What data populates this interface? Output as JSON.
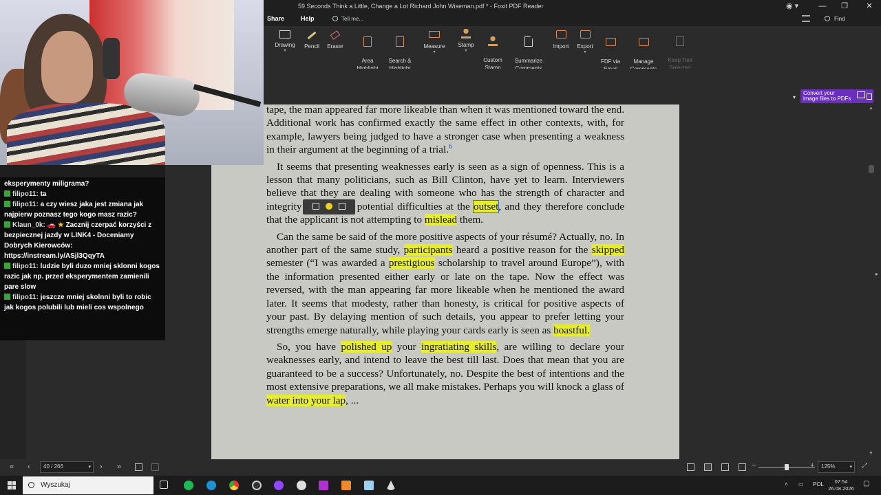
{
  "window": {
    "title": "59 Seconds Think a Little, Change a Lot Richard John Wiseman.pdf * - Foxit PDF Reader",
    "minimize": "—",
    "restore": "❐",
    "close": "✕",
    "user_icon": "user-icon"
  },
  "menu": {
    "tabs": [
      "Share",
      "Help"
    ],
    "tell_me": "Tell me...",
    "find": "Find"
  },
  "ribbon": {
    "buttons": [
      {
        "label": "Drawing",
        "icon": "rectangle-icon",
        "dropdown": true
      },
      {
        "label": "Pencil",
        "icon": "pencil-icon"
      },
      {
        "label": "Eraser",
        "icon": "eraser-icon"
      },
      {
        "label": "Area\nHighlight",
        "icon": "area-highlight-icon"
      },
      {
        "label": "Search &\nHighlight",
        "icon": "search-highlight-icon"
      },
      {
        "label": "Measure",
        "icon": "ruler-icon",
        "dropdown": true
      },
      {
        "label": "Stamp",
        "icon": "stamp-icon",
        "dropdown": true
      },
      {
        "label": "Custom\nStamp",
        "icon": "custom-stamp-icon",
        "dropdown": true
      },
      {
        "label": "Summarize\nComments",
        "icon": "summarize-icon"
      },
      {
        "label": "Import",
        "icon": "import-icon"
      },
      {
        "label": "Export",
        "icon": "export-icon",
        "dropdown": true
      },
      {
        "label": "FDF via\nEmail",
        "icon": "fdf-email-icon"
      },
      {
        "label": "Manage\nComments",
        "icon": "manage-comments-icon",
        "dropdown": true
      },
      {
        "label": "Keep Tool\nSelected",
        "icon": "keep-tool-icon",
        "disabled": true
      }
    ],
    "convert_banner": "Convert your\nimage files to PDFs"
  },
  "document": {
    "paragraphs": [
      {
        "indent": false,
        "segments": [
          {
            "t": "tape, the man appeared far more likeable than when it was mentioned toward the end. Additional work has confirmed exactly the same effect in other contexts, with, for example, lawyers being judged to have a stronger case when presenting a weakness in their argument at the beginning of a trial."
          },
          {
            "t": "6",
            "sup": true
          }
        ]
      },
      {
        "indent": true,
        "segments": [
          {
            "t": "It seems that presenting weaknesses early is seen as a sign of openness. This is a lesson that many politicians, such as Bill Clinton, have yet to learn. Interviewers believe that they are dealing with someone who has the strength of character and integrity to bring up potential difficulties at the "
          },
          {
            "t": "outset",
            "hl": true,
            "sel": true
          },
          {
            "t": ", and they therefore conclude that the applicant is not attempting to "
          },
          {
            "t": "mislead",
            "hl": true
          },
          {
            "t": " them."
          }
        ]
      },
      {
        "indent": true,
        "segments": [
          {
            "t": "Can the same be said of the more positive aspects of your résumé? Actually, no. In another part of the same study, "
          },
          {
            "t": "participants",
            "hl": true
          },
          {
            "t": " heard a positive reason for the "
          },
          {
            "t": "skipped",
            "hl": true
          },
          {
            "t": " semester (“I was awarded a "
          },
          {
            "t": "prestigious",
            "hl": true
          },
          {
            "t": " scholarship to travel around Europe”), with the information presented either early or late on the tape. Now the effect was reversed, with the man appearing far more likeable when he mentioned the award later. It seems that modesty, rather than honesty, is critical for positive aspects of your past. By delaying mention of such details, you appear to prefer letting your strengths emerge naturally, while playing your cards early is seen as "
          },
          {
            "t": "boastful.",
            "hl": true
          }
        ]
      },
      {
        "indent": true,
        "segments": [
          {
            "t": "So, you have "
          },
          {
            "t": "polished up",
            "hl": true
          },
          {
            "t": " your "
          },
          {
            "t": "ingratiating skills",
            "hl": true
          },
          {
            "t": ", are willing to declare your weaknesses early, and intend to leave the best till last. Does that mean that you are guaranteed to be a success? Unfortunately, no. Despite the best of intentions and the most extensive preparations, we all make mistakes. Perhaps you will knock a glass of "
          },
          {
            "t": "water into your lap",
            "hl": true
          },
          {
            "t": ", ..."
          }
        ]
      }
    ],
    "highlight_color": "#e7ec2b",
    "page_color": "#c9c9c4"
  },
  "status": {
    "page_indicator": "40 / 266",
    "zoom": "125%"
  },
  "chat": {
    "messages": [
      {
        "text": "eksperymenty miligrama?"
      },
      {
        "user": "filipo11:",
        "text": "ta"
      },
      {
        "user": "filipo11:",
        "text": "a czy wiesz jaka jest zmiana jak najpierw poznasz tego kogo masz razic?"
      },
      {
        "user": "Klaun_0k:",
        "emoji": true,
        "text": "Zacznij czerpać korzyści z bezpiecznej jazdy w LINK4 - Doceniamy Dobrych Kierowców: https://instream.ly/ASjl3QqyTA"
      },
      {
        "user": "filipo11:",
        "text": "ludzie byli duzo mniej sklonni kogos razic jak np. przed eksperymentem zamienili pare slow"
      },
      {
        "user": "filipo11:",
        "text": "jeszcze mniej skolnni byli to robic jak kogos polubili lub mieli cos wspolnego"
      }
    ],
    "badge_color": "#3aa33a"
  },
  "taskbar": {
    "search_placeholder": "Wyszukaj",
    "language": "POL",
    "time": "07:54",
    "date": "26.08.2026"
  }
}
